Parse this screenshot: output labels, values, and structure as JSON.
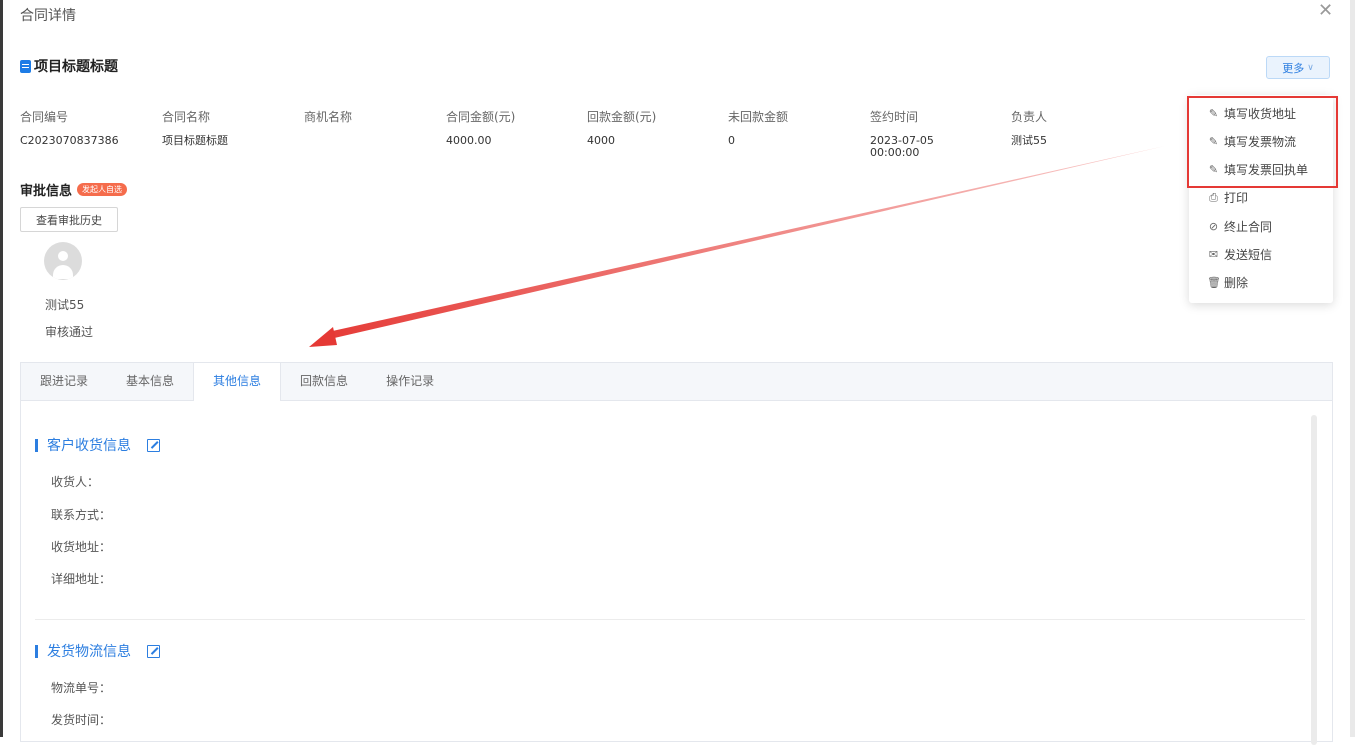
{
  "dialog": {
    "title": "合同详情",
    "close_icon": "close-icon"
  },
  "project": {
    "title": "项目标题标题",
    "more_label": "更多"
  },
  "contract_info": [
    {
      "label": "合同编号",
      "value": "C2023070837386"
    },
    {
      "label": "合同名称",
      "value": "项目标题标题"
    },
    {
      "label": "商机名称",
      "value": ""
    },
    {
      "label": "合同金额(元)",
      "value": "4000.00"
    },
    {
      "label": "回款金额(元)",
      "value": "4000"
    },
    {
      "label": "未回款金额",
      "value": "0"
    },
    {
      "label": "签约时间",
      "value": "2023-07-05",
      "value2": "00:00:00"
    },
    {
      "label": "负责人",
      "value": "测试55"
    }
  ],
  "approval": {
    "title": "审批信息",
    "badge": "发起人自选",
    "history_button": "查看审批历史",
    "user": "测试55",
    "status": "审核通过"
  },
  "tabs": [
    {
      "label": "跟进记录",
      "active": false
    },
    {
      "label": "基本信息",
      "active": false
    },
    {
      "label": "其他信息",
      "active": true
    },
    {
      "label": "回款信息",
      "active": false
    },
    {
      "label": "操作记录",
      "active": false
    }
  ],
  "sections": {
    "receiving": {
      "title": "客户收货信息",
      "fields": [
        "收货人：",
        "联系方式：",
        "收货地址：",
        "详细地址："
      ]
    },
    "logistics": {
      "title": "发货物流信息",
      "fields": [
        "物流单号：",
        "发货时间："
      ]
    }
  },
  "more_menu": [
    {
      "label": "填写收货地址",
      "icon": "edit-icon"
    },
    {
      "label": "填写发票物流",
      "icon": "edit-icon"
    },
    {
      "label": "填写发票回执单",
      "icon": "edit-icon"
    },
    {
      "label": "打印",
      "icon": "printer-icon"
    },
    {
      "label": "终止合同",
      "icon": "stop-icon"
    },
    {
      "label": "发送短信",
      "icon": "mail-icon"
    },
    {
      "label": "删除",
      "icon": "trash-icon"
    }
  ],
  "colors": {
    "accent": "#2c7ee0",
    "annotation": "#e53935",
    "badge": "#f56c4c"
  }
}
